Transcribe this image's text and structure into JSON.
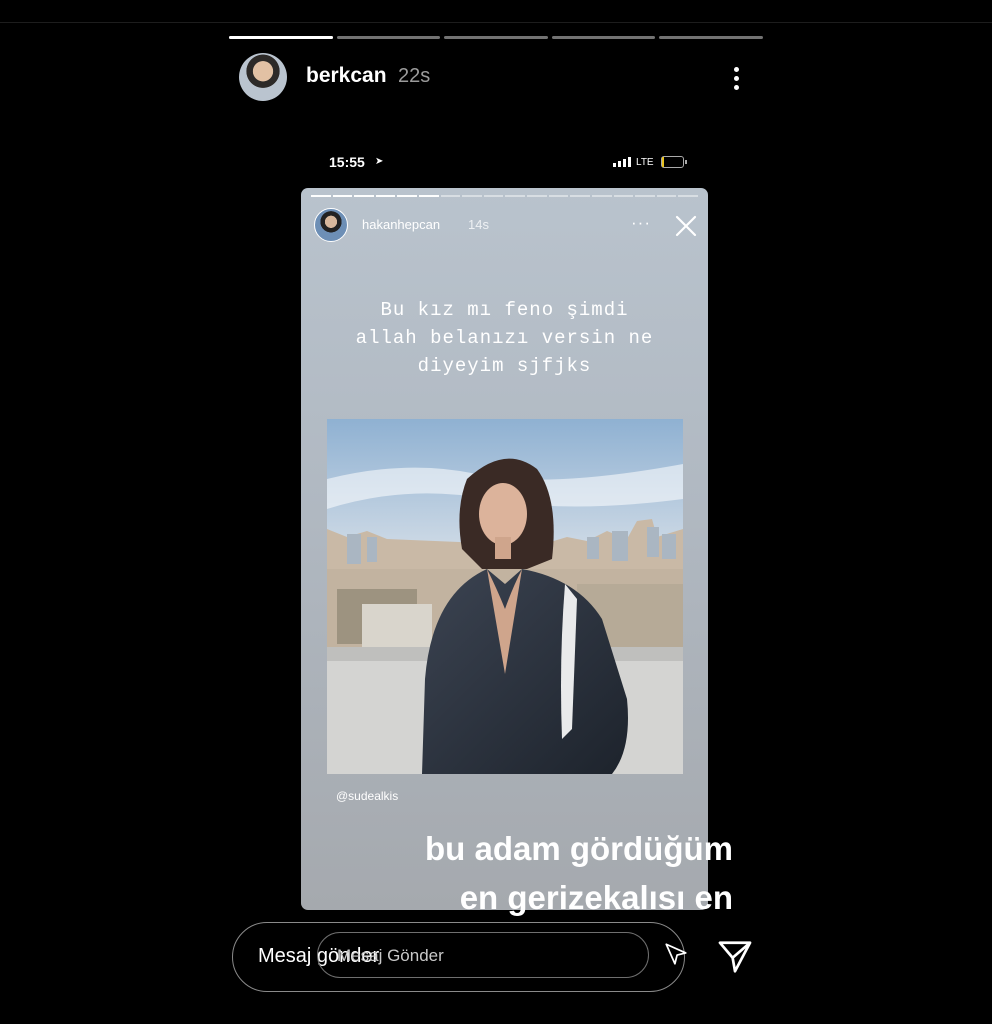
{
  "story": {
    "username": "berkcan",
    "time": "22s",
    "progress": [
      1,
      0,
      0,
      0,
      0
    ],
    "menu_icon": "more-vertical-icon"
  },
  "phone_status": {
    "time": "15:55",
    "network": "LTE",
    "battery_level": 0.1,
    "battery_color": "#e8c21f"
  },
  "shared_story": {
    "username": "hakanhepcan",
    "time": "14s",
    "caption_lines": [
      "Bu kız mı feno şimdi",
      "allah belanızı versin ne",
      "diyeyim sjfjks"
    ],
    "mention": "@sudealkis",
    "progress_segments": 18,
    "progress_filled": 6,
    "more_icon": "more-horizontal-icon",
    "close_icon": "close-icon"
  },
  "overlay_text": [
    "bu adam gördüğüm",
    "en gerizekalısı en"
  ],
  "message_bar": {
    "placeholder": "Mesaj gönder",
    "inner_placeholder": "Mesaj Gönder",
    "send_icon": "send-icon"
  }
}
